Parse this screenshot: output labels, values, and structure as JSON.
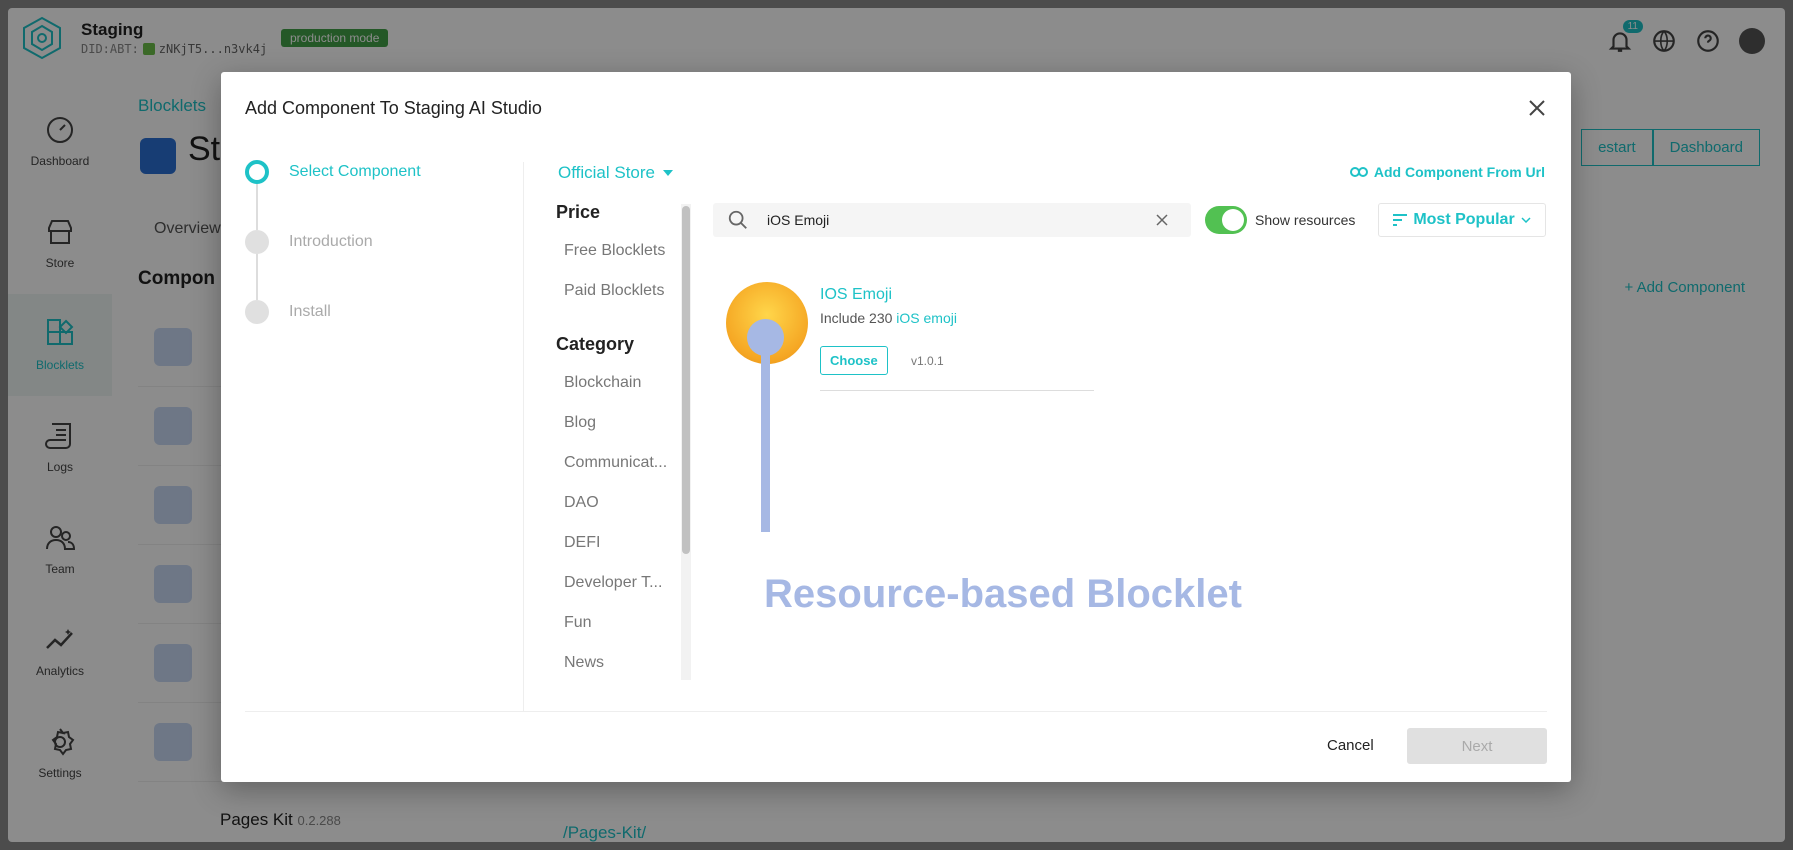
{
  "app": {
    "title": "Staging",
    "did_label": "DID:ABT:",
    "did_value": "zNKjT5...n3vk4j",
    "mode_badge": "production mode",
    "notification_count": "11"
  },
  "sidebar": {
    "items": [
      {
        "label": "Dashboard",
        "icon": "gauge-icon"
      },
      {
        "label": "Store",
        "icon": "store-icon"
      },
      {
        "label": "Blocklets",
        "icon": "blocks-icon"
      },
      {
        "label": "Logs",
        "icon": "logs-icon"
      },
      {
        "label": "Team",
        "icon": "team-icon"
      },
      {
        "label": "Analytics",
        "icon": "analytics-icon"
      },
      {
        "label": "Settings",
        "icon": "gear-icon"
      }
    ]
  },
  "background": {
    "breadcrumb": "Blocklets",
    "title": "St",
    "tab": "Overview",
    "section": "Compon",
    "restart": "estart",
    "dashboard": "Dashboard",
    "add_component": "+ Add Component",
    "last_row_name": "Pages Kit",
    "last_row_version": "0.2.288",
    "last_row_path": "/Pages-Kit/"
  },
  "modal": {
    "title": "Add Component To Staging AI Studio",
    "steps": [
      "Select Component",
      "Introduction",
      "Install"
    ],
    "store": "Official Store",
    "add_from_url": "Add Component From Url",
    "filters": {
      "price_title": "Price",
      "price_items": [
        "Free Blocklets",
        "Paid Blocklets"
      ],
      "category_title": "Category",
      "category_items": [
        "Blockchain",
        "Blog",
        "Communicat...",
        "DAO",
        "DEFI",
        "Developer T...",
        "Fun",
        "News"
      ]
    },
    "search": {
      "value": "iOS Emoji"
    },
    "show_resources_label": "Show resources",
    "sort_label": "Most Popular",
    "result": {
      "name": "IOS Emoji",
      "desc_prefix": "Include 230 ",
      "desc_highlight": "iOS emoji",
      "choose": "Choose",
      "version": "v1.0.1"
    },
    "annotation": "Resource-based Blocklet",
    "cancel": "Cancel",
    "next": "Next"
  },
  "colors": {
    "accent": "#1ec2c7",
    "annotation": "#a6b8e4",
    "toggle": "#52c152"
  }
}
